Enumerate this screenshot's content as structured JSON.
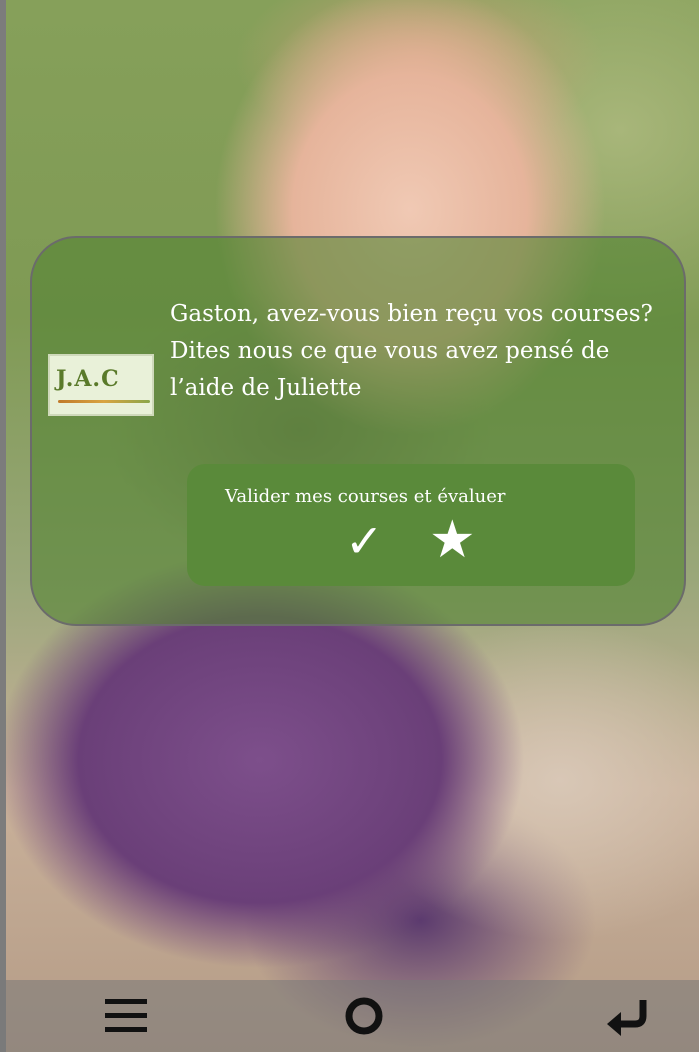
{
  "dialog": {
    "logo_text": "J.A.C",
    "message": "Gaston, avez-vous bien reçu vos courses? Dites nous ce que vous avez pensé de l’aide de Juliette",
    "action_button_label": "Valider mes courses et évaluer",
    "icons": [
      "check-icon",
      "star-icon"
    ]
  },
  "nav": {
    "icons": [
      "menu-icon",
      "home-icon",
      "back-icon"
    ]
  },
  "colors": {
    "card_tint": "#568436",
    "button": "#5a8a3a",
    "text": "#ffffff"
  }
}
